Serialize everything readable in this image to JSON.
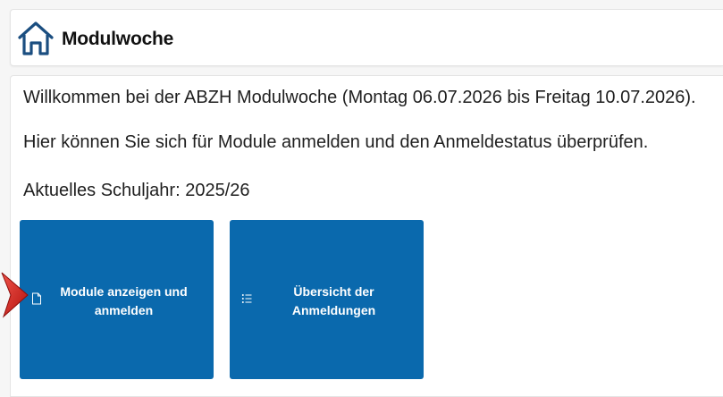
{
  "header": {
    "title": "Modulwoche",
    "icon": "home-icon"
  },
  "intro": {
    "welcome": "Willkommen bei der ABZH Modulwoche (Montag 06.07.2026 bis Freitag 10.07.2026).",
    "info": "Hier können Sie sich für Module anmelden und den Anmeldestatus überprüfen.",
    "school_year": "Aktuelles Schuljahr: 2025/26"
  },
  "tiles": [
    {
      "label": "Module anzeigen und anmelden",
      "icon": "document-icon"
    },
    {
      "label": "Übersicht der Anmeldungen",
      "icon": "list-icon"
    }
  ],
  "colors": {
    "tile_background": "#0a69ad",
    "home_icon": "#1b4e80",
    "pointer_arrow": "#d9231c"
  }
}
